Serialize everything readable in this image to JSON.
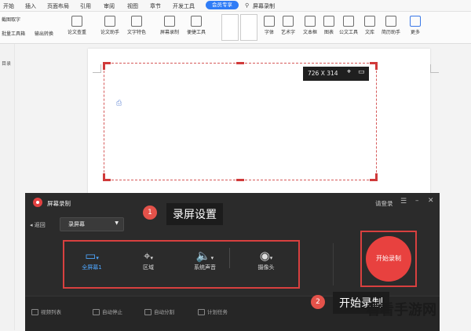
{
  "menubar": {
    "items": [
      "开始",
      "插入",
      "页面布局",
      "引用",
      "审阅",
      "视图",
      "章节",
      "开发工具"
    ],
    "vip_label": "会员专享",
    "search_label": "屏幕录制"
  },
  "ribbon": {
    "left_labels": [
      "截图取字",
      "批量工具箱",
      "输出转换"
    ],
    "buttons": [
      "论文查重",
      "论文助手",
      "文字特色",
      "屏幕录制",
      "便捷工具",
      "字体",
      "艺术字",
      "文本框",
      "图表",
      "公文工具",
      "文库",
      "简历助手",
      "更多"
    ]
  },
  "sidebar": {
    "label": "目录"
  },
  "selection": {
    "size_text": "726 X 314"
  },
  "recorder": {
    "title": "屏幕录制",
    "login": "请登录",
    "back": "返回",
    "mode": "录屏幕",
    "options": [
      {
        "label": "全屏幕1",
        "icon": "monitor-icon"
      },
      {
        "label": "区域",
        "icon": "crop-icon"
      },
      {
        "label": "系统声音",
        "icon": "speaker-icon"
      },
      {
        "label": "摄像头",
        "icon": "webcam-icon"
      }
    ],
    "start": "开始录制",
    "footer": [
      "视频列表",
      "自动停止",
      "自动分割",
      "计划任务"
    ]
  },
  "callouts": [
    {
      "num": "1",
      "text": "录屏设置"
    },
    {
      "num": "2",
      "text": "开始录制"
    }
  ],
  "watermark": "看看手游网",
  "colors": {
    "accent_red": "#e8413f",
    "active_blue": "#4fa7ff",
    "vip_blue": "#2f7cf6"
  }
}
